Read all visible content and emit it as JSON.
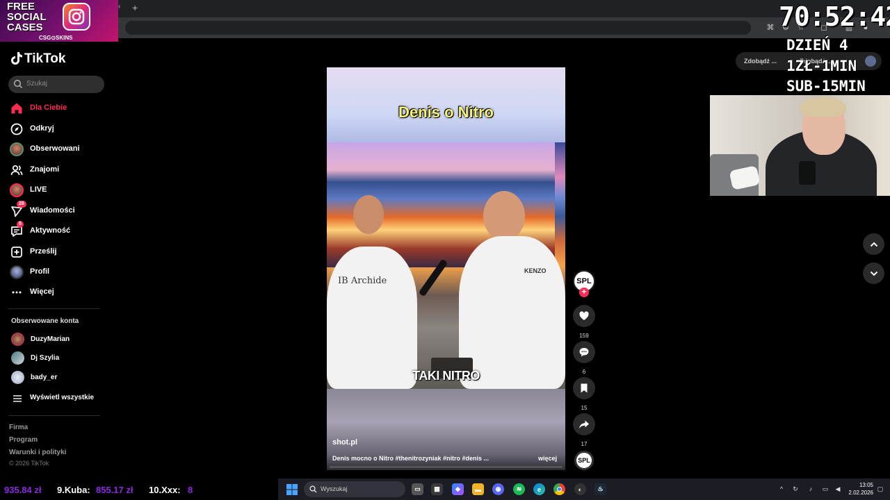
{
  "promo": {
    "line1": "FREE",
    "line2": "SOCIAL",
    "line3": "CASES",
    "sub": "CSG⊙SKINS"
  },
  "stream": {
    "timer": "70:52:42",
    "day": "DZIEŃ 4",
    "rate1": "1ZŁ-1MIN",
    "rate2": "SUB-15MIN"
  },
  "pill": {
    "left": "Zdobądź ...",
    "right": "Zdobądź..."
  },
  "tiktok": {
    "logo": "TikTok",
    "search_placeholder": "Szukaj",
    "nav": [
      {
        "label": "Dla Ciebie",
        "icon": "home-icon",
        "active": true
      },
      {
        "label": "Odkryj",
        "icon": "compass-icon"
      },
      {
        "label": "Obserwowani",
        "icon": "following-avatar-icon"
      },
      {
        "label": "Znajomi",
        "icon": "friends-icon"
      },
      {
        "label": "LIVE",
        "icon": "live-avatar-icon"
      },
      {
        "label": "Wiadomości",
        "icon": "messages-icon",
        "badge": "28"
      },
      {
        "label": "Aktywność",
        "icon": "activity-icon",
        "badge": "5"
      },
      {
        "label": "Prześlij",
        "icon": "upload-icon"
      },
      {
        "label": "Profil",
        "icon": "profile-avatar-icon"
      },
      {
        "label": "Więcej",
        "icon": "more-icon"
      }
    ],
    "following_title": "Obserwowane konta",
    "accounts": [
      {
        "name": "DuzyMarian"
      },
      {
        "name": "Dj Szylia"
      },
      {
        "name": "bady_er"
      }
    ],
    "show_all": "Wyświetl wszystkie",
    "footer": [
      "Firma",
      "Program",
      "Warunki i polityki"
    ],
    "copyright": "© 2026 TikTok"
  },
  "video": {
    "title": "Denis o Nitro",
    "caption": "TAKI NITRO",
    "shirt_left": "IB Archide",
    "shirt_right": "KENZO",
    "source": "shot.pl",
    "description": "Denis mocno o Nitro #thenitrozyniak #nitro #denis ...",
    "more": "więcej",
    "creator_initials": "SPL",
    "likes": "159",
    "comments": "6",
    "saves": "15",
    "shares": "17"
  },
  "ticker": {
    "item1_amount": "935.84 zł",
    "item2_name": "9.Kuba:",
    "item2_amount": "855.17 zł",
    "item3_name": "10.Xxx:",
    "item3_amount": "8"
  },
  "taskbar": {
    "search_placeholder": "Wyszukaj",
    "time": "13:05",
    "date": "2.02.2026"
  },
  "colors": {
    "accent": "#fe2c55",
    "ticker_amount": "#8a2be2"
  }
}
